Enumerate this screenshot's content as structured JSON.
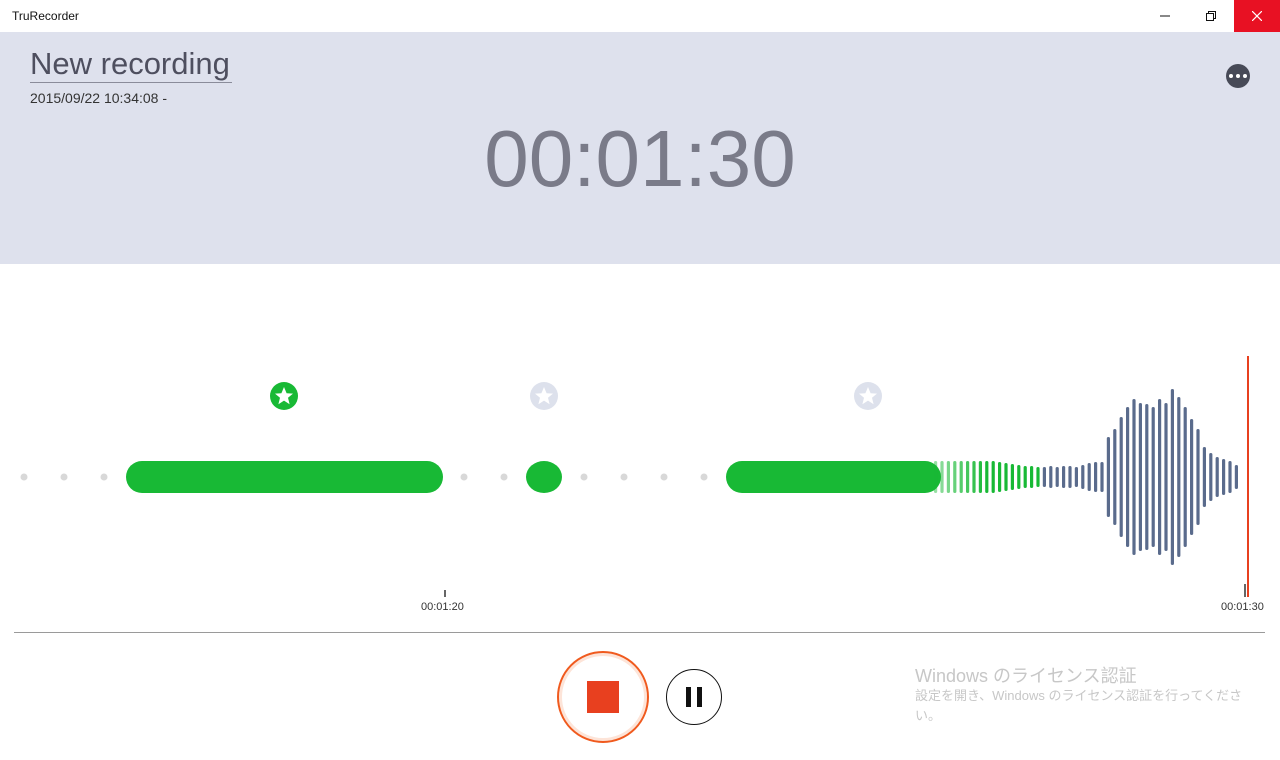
{
  "window": {
    "title": "TruRecorder",
    "controls": [
      "minimize-icon",
      "restore-icon",
      "close-icon"
    ],
    "close_color": "#e81123"
  },
  "header": {
    "recording_name": "New recording",
    "date": "2015/09/22 10:34:08 -",
    "timer": "00:01:30",
    "more_icon": "more-icon",
    "background": "#dee1ed"
  },
  "timeline": {
    "labels": [
      "00:01:20",
      "00:01:30"
    ],
    "bookmarks": [
      {
        "icon": "star-icon",
        "state": "active",
        "color": "#18b935"
      },
      {
        "icon": "star-icon",
        "state": "inactive",
        "color": "#dde1ec"
      },
      {
        "icon": "star-icon",
        "state": "inactive",
        "color": "#dde1ec"
      }
    ],
    "colors": {
      "recorded": "#18b935",
      "live": "#5a6b8c",
      "playhead": "#e8401f",
      "silence_dot": "#d8d8d8"
    }
  },
  "controls": {
    "stop_icon": "stop-icon",
    "pause_icon": "pause-icon",
    "stop_color": "#e8401f"
  },
  "watermark": {
    "title": "Windows のライセンス認証",
    "text": "設定を開き、Windows のライセンス認証を行ってください。"
  }
}
